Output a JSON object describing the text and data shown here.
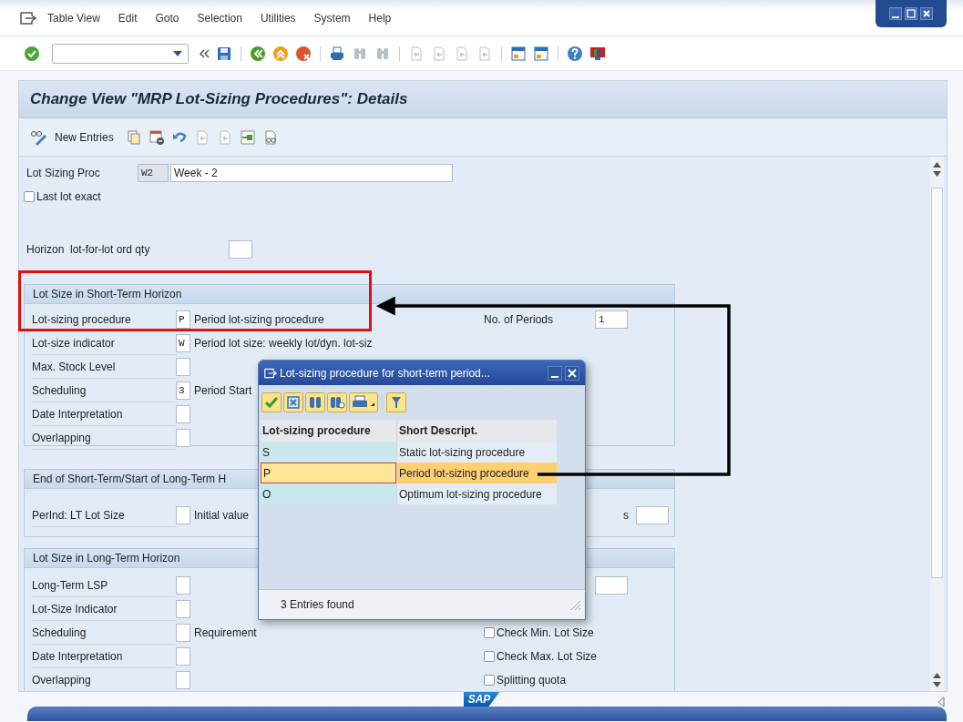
{
  "menu_bar": {
    "items": [
      "Table View",
      "Edit",
      "Goto",
      "Selection",
      "Utilities",
      "System",
      "Help"
    ]
  },
  "screen_title": "Change View \"MRP Lot-Sizing Procedures\": Details",
  "app_toolbar": {
    "new_entries": "New Entries"
  },
  "header": {
    "lot_sizing_proc": {
      "label": "Lot Sizing Proc",
      "key": "W2",
      "text": "Week - 2"
    },
    "last_lot_exact": {
      "label": "Last lot exact",
      "checked": false
    },
    "horizon": {
      "label": "Horizon  lot-for-lot ord qty"
    }
  },
  "groups": [
    {
      "title": "Lot Size in Short-Term Horizon",
      "rows": [
        {
          "label": "Lot-sizing procedure",
          "value": "P",
          "text": "Period lot-sizing procedure",
          "right": {
            "kind": "field",
            "label": "No. of Periods",
            "value": "1"
          }
        },
        {
          "label": "Lot-size indicator",
          "value": "W",
          "text": "Period lot size: weekly lot/dyn. lot-siz"
        },
        {
          "label": "Max. Stock Level"
        },
        {
          "label": "Scheduling",
          "value": "3",
          "text": "Period Start"
        },
        {
          "label": "Date Interpretation"
        },
        {
          "label": "Overlapping"
        }
      ]
    },
    {
      "title": "End of Short-Term/Start of Long-Term H",
      "rows": [
        {
          "label": "PerInd: LT Lot Size",
          "text": "Initial value",
          "right": {
            "kind": "field",
            "label": "s"
          }
        }
      ]
    },
    {
      "title": "Lot Size in Long-Term Horizon",
      "rows": [
        {
          "label": "Long-Term LSP",
          "right": {
            "kind": "field"
          }
        },
        {
          "label": "Lot-Size Indicator"
        },
        {
          "label": "Scheduling",
          "text": "Requirement",
          "right": {
            "kind": "checkbox",
            "label": "Check Min. Lot Size",
            "checked": false
          }
        },
        {
          "label": "Date Interpretation",
          "right": {
            "kind": "checkbox",
            "label": "Check Max. Lot Size",
            "checked": false
          }
        },
        {
          "label": "Overlapping",
          "right": {
            "kind": "checkbox",
            "label": "Splitting quota",
            "checked": false
          }
        }
      ]
    }
  ],
  "popup": {
    "title": "Lot-sizing procedure for short-term period...",
    "columns": [
      "Lot-sizing procedure",
      "Short Descript."
    ],
    "rows": [
      {
        "cells": [
          "S",
          "Static lot-sizing procedure"
        ],
        "selected": false
      },
      {
        "cells": [
          "P",
          "Period lot-sizing procedure"
        ],
        "selected": true
      },
      {
        "cells": [
          "O",
          "Optimum lot-sizing procedure"
        ],
        "selected": false
      }
    ],
    "status": "3 Entries found"
  },
  "footer": {
    "logo": "SAP"
  }
}
